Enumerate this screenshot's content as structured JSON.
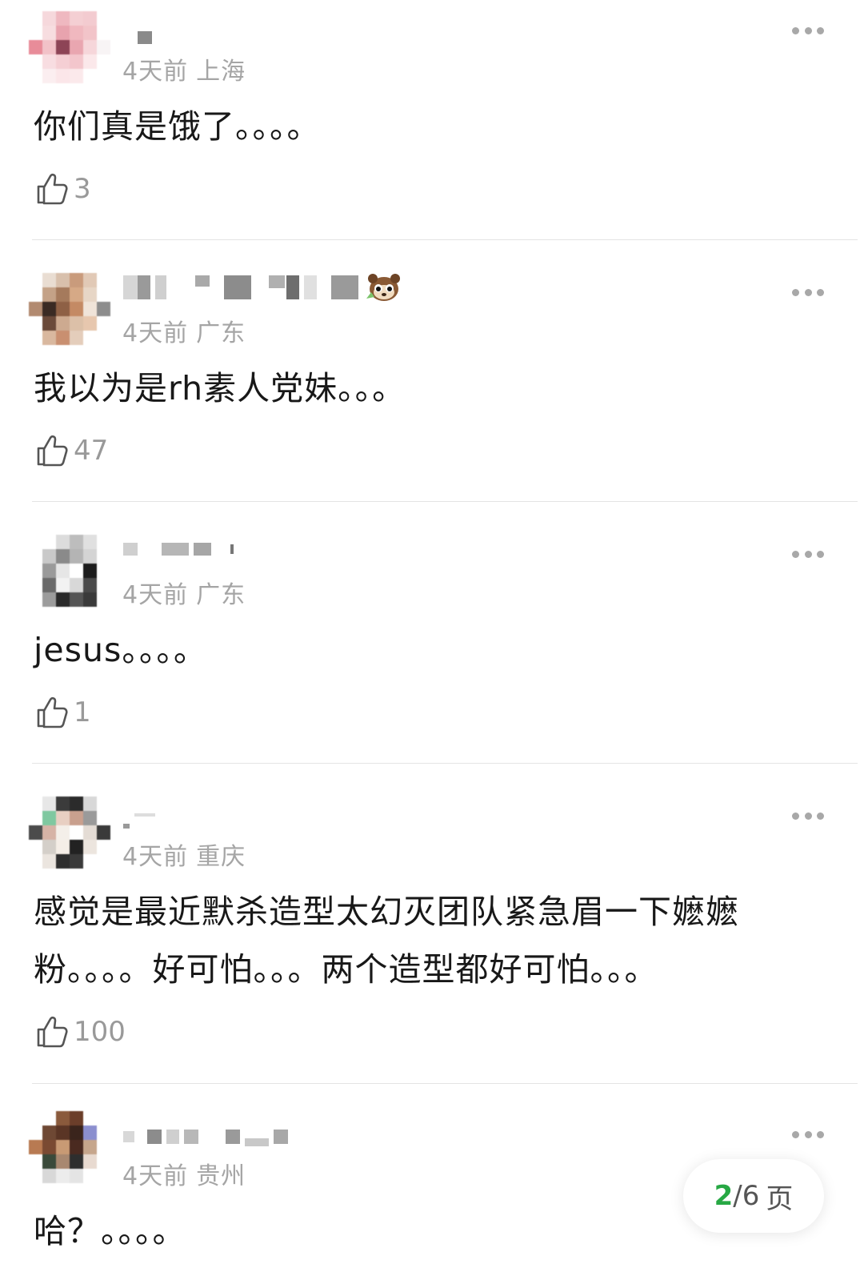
{
  "colors": {
    "accent_green": "#27a844",
    "meta_gray": "#a5a5a5",
    "divider": "#e4e4e4"
  },
  "comments": [
    {
      "time": "4天前",
      "location": "上海",
      "text": "你们真是饿了。。。。",
      "likes": "3",
      "avatar_icon": "blurred-avatar-icon"
    },
    {
      "time": "4天前",
      "location": "广东",
      "text": "我以为是rh素人党妹。。。",
      "likes": "47",
      "avatar_icon": "blurred-avatar-icon",
      "badge_icon": "raccoon-emoji-icon"
    },
    {
      "time": "4天前",
      "location": "广东",
      "text": "jesus。。。。",
      "likes": "1",
      "avatar_icon": "blurred-avatar-icon"
    },
    {
      "time": "4天前",
      "location": "重庆",
      "text": "感觉是最近默杀造型太幻灭团队紧急眉一下嬷嬷粉。。。。好可怕。。。两个造型都好可怕。。。",
      "likes": "100",
      "avatar_icon": "blurred-avatar-icon"
    },
    {
      "time": "4天前",
      "location": "贵州",
      "text": "哈？。。。。",
      "likes": "",
      "avatar_icon": "blurred-avatar-icon"
    }
  ],
  "pager": {
    "current": "2",
    "total": "/6",
    "unit": "页"
  }
}
